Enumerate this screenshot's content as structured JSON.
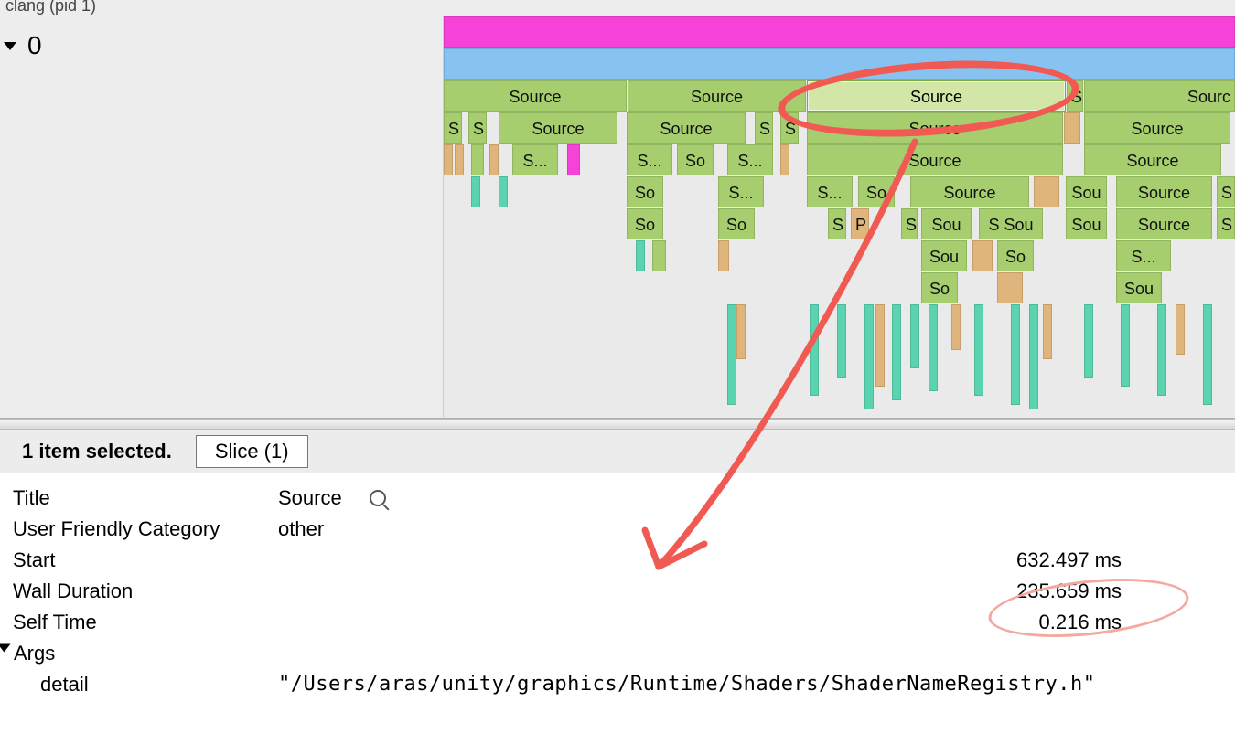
{
  "header": {
    "process_label": "clang (pid 1)"
  },
  "sidebar": {
    "row_label": "0"
  },
  "flame": {
    "label_source": "Source",
    "label_s": "S",
    "label_sdot": "S...",
    "label_so": "So",
    "label_sou": "Sou",
    "label_sourc": "Sourc",
    "label_p": "P",
    "label_ssou": "S Sou"
  },
  "selection": {
    "summary": "1 item selected.",
    "tab_label": "Slice (1)"
  },
  "details": {
    "title_key": "Title",
    "title_val": "Source",
    "cat_key": "User Friendly Category",
    "cat_val": "other",
    "start_key": "Start",
    "start_val": "632.497 ms",
    "wall_key": "Wall Duration",
    "wall_val": "235.659 ms",
    "self_key": "Self Time",
    "self_val": "0.216 ms",
    "args_label": "Args",
    "detail_key": "detail",
    "detail_val": "\"/Users/aras/unity/graphics/Runtime/Shaders/ShaderNameRegistry.h\""
  }
}
